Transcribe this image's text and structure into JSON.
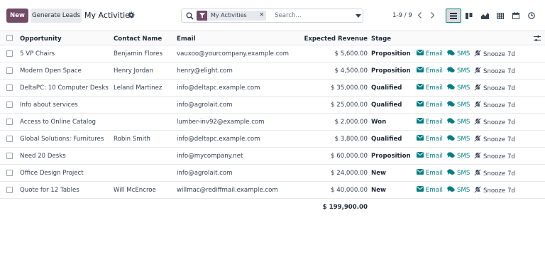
{
  "control_panel": {
    "new_label": "New",
    "generate_label": "Generate Leads",
    "title": "My Activities",
    "search": {
      "facet_label": "My Activities",
      "facet_close": "×",
      "placeholder": "Search..."
    },
    "pager": {
      "text": "1-9 / 9"
    }
  },
  "columns": {
    "opportunity": "Opportunity",
    "contact": "Contact Name",
    "email": "Email",
    "revenue": "Expected Revenue",
    "stage": "Stage"
  },
  "actions": {
    "email": "Email",
    "sms": "SMS",
    "snooze": "Snooze 7d"
  },
  "rows": [
    {
      "opportunity": "5 VP Chairs",
      "contact": "Benjamin Flores",
      "email": "vauxoo@yourcompany.example.com",
      "revenue": "$ 5,600.00",
      "stage": "Proposition"
    },
    {
      "opportunity": "Modern Open Space",
      "contact": "Henry Jordan",
      "email": "henry@elight.com",
      "revenue": "$ 4,500.00",
      "stage": "Proposition"
    },
    {
      "opportunity": "DeltaPC: 10 Computer Desks",
      "contact": "Leland Martinez",
      "email": "info@deltapc.example.com",
      "revenue": "$ 35,000.00",
      "stage": "Qualified"
    },
    {
      "opportunity": "Info about services",
      "contact": "",
      "email": "info@agrolait.com",
      "revenue": "$ 25,000.00",
      "stage": "Qualified"
    },
    {
      "opportunity": "Access to Online Catalog",
      "contact": "",
      "email": "lumber-inv92@example.com",
      "revenue": "$ 2,000.00",
      "stage": "Won"
    },
    {
      "opportunity": "Global Solutions: Furnitures",
      "contact": "Robin Smith",
      "email": "info@deltapc.example.com",
      "revenue": "$ 3,800.00",
      "stage": "Qualified"
    },
    {
      "opportunity": "Need 20 Desks",
      "contact": "",
      "email": "info@mycompany.net",
      "revenue": "$ 60,000.00",
      "stage": "Proposition"
    },
    {
      "opportunity": "Office Design Project",
      "contact": "",
      "email": "info@agrolait.com",
      "revenue": "$ 24,000.00",
      "stage": "New"
    },
    {
      "opportunity": "Quote for 12 Tables",
      "contact": "Will McEncroe",
      "email": "willmac@rediffmail.example.com",
      "revenue": "$ 40,000.00",
      "stage": "New"
    }
  ],
  "total_revenue": "$ 199,900.00",
  "colors": {
    "brand": "#714b67",
    "accent": "#017e84"
  },
  "icons": {
    "title_gear": "gear-icon",
    "search": "search-icon",
    "facet": "filter-icon",
    "views": [
      "list-view-icon",
      "kanban-view-icon",
      "graph-view-icon",
      "pivot-view-icon",
      "calendar-view-icon",
      "activity-view-icon"
    ],
    "optional_columns": "sliders-icon"
  }
}
